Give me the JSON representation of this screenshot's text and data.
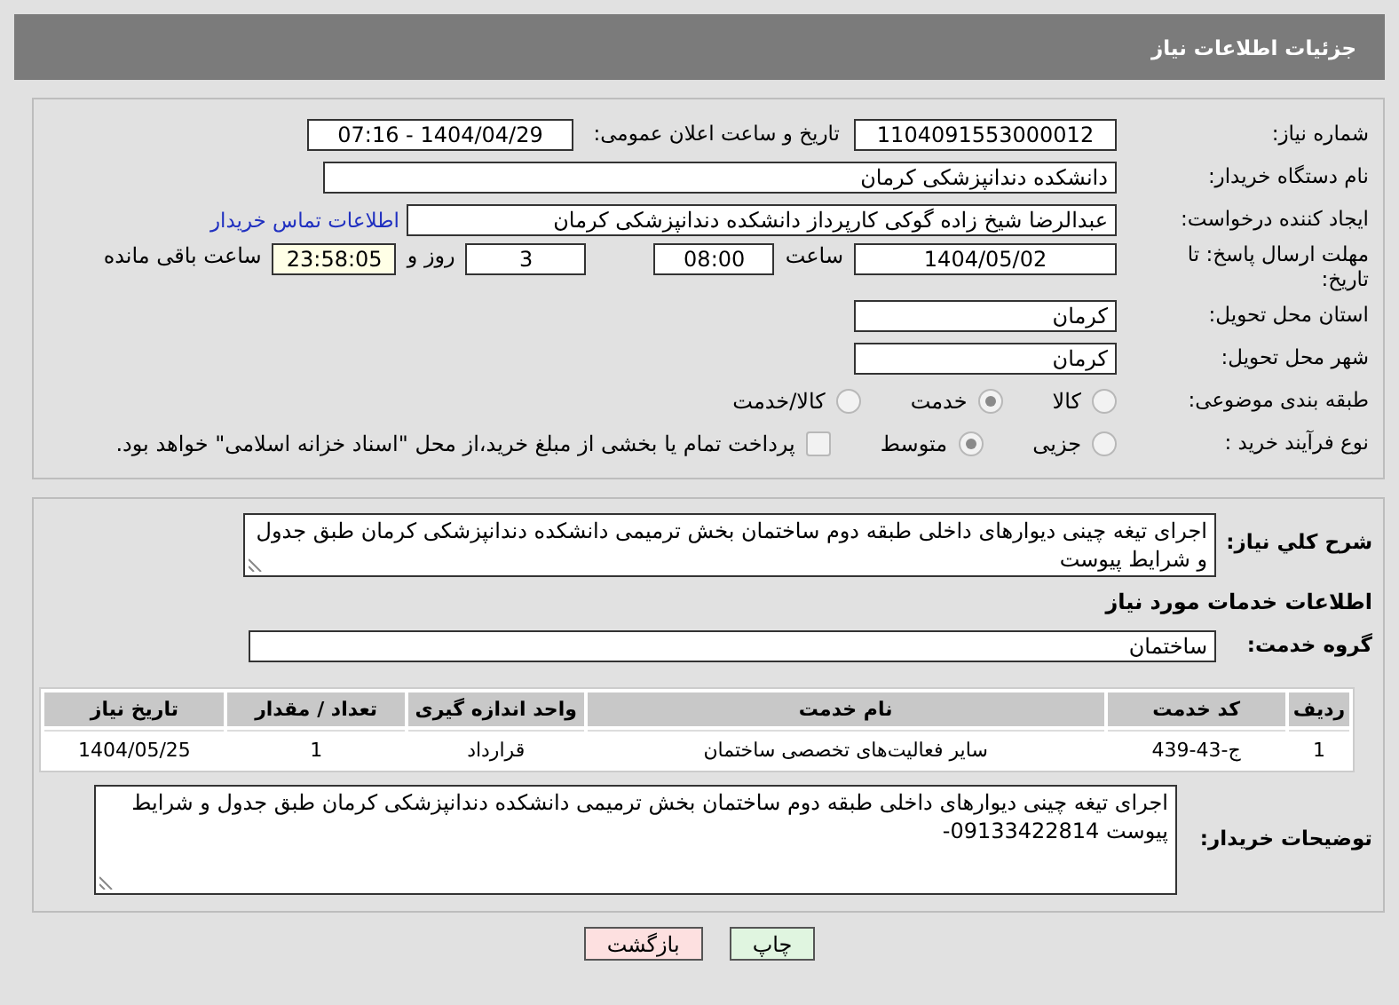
{
  "header": {
    "title": "جزئیات اطلاعات نیاز"
  },
  "need_info": {
    "need_number": {
      "label": "شماره نیاز:",
      "value": "1104091553000012"
    },
    "announce_datetime": {
      "label": "تاریخ و ساعت اعلان عمومی:",
      "value": "1404/04/29 - 07:16"
    },
    "buyer_org": {
      "label": "نام دستگاه خریدار:",
      "value": "دانشکده دندانپزشکی کرمان"
    },
    "requester": {
      "label": "ایجاد کننده درخواست:",
      "value": "عبدالرضا شیخ زاده گوکی کارپرداز دانشکده دندانپزشکی کرمان"
    },
    "buyer_contact_link": "اطلاعات تماس خریدار",
    "deadline": {
      "label": "مهلت ارسال پاسخ: تا تاریخ:",
      "date": "1404/05/02",
      "time_label": "ساعت",
      "time": "08:00",
      "days": "3",
      "days_label": "روز و",
      "remaining": "23:58:05",
      "remaining_label": "ساعت باقی مانده"
    },
    "province": {
      "label": "استان محل تحویل:",
      "value": "کرمان"
    },
    "city": {
      "label": "شهر محل تحویل:",
      "value": "کرمان"
    },
    "category": {
      "label": "طبقه بندی موضوعی:",
      "options": [
        {
          "label": "کالا",
          "selected": false
        },
        {
          "label": "خدمت",
          "selected": true
        },
        {
          "label": "کالا/خدمت",
          "selected": false
        }
      ]
    },
    "process": {
      "label": "نوع فرآیند خرید :",
      "options": [
        {
          "label": "جزیی",
          "selected": false
        },
        {
          "label": "متوسط",
          "selected": true
        }
      ],
      "treasury": {
        "label": "پرداخت تمام یا بخشی از مبلغ خرید،از محل \"اسناد خزانه اسلامی\" خواهد بود.",
        "checked": false
      }
    }
  },
  "services": {
    "summary": {
      "label": "شرح کلي نیاز:",
      "value": "اجرای تیغه چینی دیوارهای داخلی طبقه دوم ساختمان بخش ترمیمی دانشکده دندانپزشکی کرمان طبق جدول و شرایط پیوست"
    },
    "heading": "اطلاعات خدمات مورد نیاز",
    "group": {
      "label": "گروه خدمت:",
      "value": "ساختمان"
    },
    "table": {
      "columns": [
        "ردیف",
        "کد خدمت",
        "نام خدمت",
        "واحد اندازه گیری",
        "تعداد / مقدار",
        "تاریخ نیاز"
      ],
      "rows": [
        [
          "1",
          "ج-43-439",
          "سایر فعالیت‌های تخصصی ساختمان",
          "قرارداد",
          "1",
          "1404/05/25"
        ]
      ]
    },
    "buyer_notes": {
      "label": "توضیحات خریدار:",
      "value": "اجرای تیغه چینی دیوارهای داخلی طبقه دوم ساختمان بخش ترمیمی دانشکده دندانپزشکی کرمان طبق جدول و شرایط پیوست 09133422814-"
    }
  },
  "buttons": [
    {
      "label": "چاپ",
      "kind": "print"
    },
    {
      "label": "بازگشت",
      "kind": "back"
    }
  ]
}
